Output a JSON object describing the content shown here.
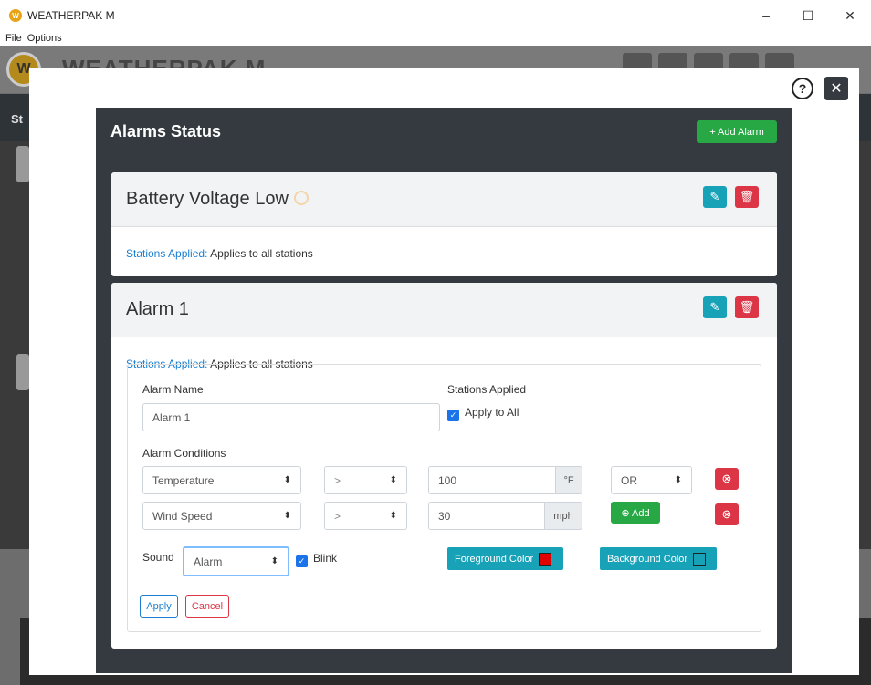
{
  "window": {
    "title": "WEATHERPAK M",
    "min": "–",
    "max": "☐",
    "close": "✕"
  },
  "menu": [
    "File",
    "Options"
  ],
  "app": {
    "logo_text": "W",
    "name": "WEATHERPAK M",
    "nav_text": "St"
  },
  "modal": {
    "help": "?",
    "close": "✕",
    "title": "Alarms Status",
    "add_alarm": "+  Add Alarm",
    "cards": [
      {
        "name": "Battery Voltage Low",
        "stations_label": "Stations Applied:",
        "stations_value": "Applies to all stations"
      },
      {
        "name": "Alarm 1",
        "stations_label": "Stations Applied:",
        "stations_value": "Applies to all stations"
      }
    ],
    "form": {
      "alarm_name_label": "Alarm Name",
      "alarm_name_value": "Alarm 1",
      "stations_applied_label": "Stations Applied",
      "apply_to_all": "Apply to All",
      "conditions_label": "Alarm Conditions",
      "conditions": [
        {
          "field": "Temperature",
          "operator": ">",
          "value": "100",
          "unit": "°F",
          "logic": "OR"
        },
        {
          "field": "Wind Speed",
          "operator": ">",
          "value": "30",
          "unit": "mph"
        }
      ],
      "add_label": "⊕ Add",
      "sound_label": "Sound",
      "sound_value": "Alarm",
      "blink_label": "Blink",
      "foreground_label": "Foreground Color",
      "background_label": "Background Color",
      "apply": "Apply",
      "cancel": "Cancel"
    }
  },
  "colors": {
    "foreground_swatch": "#e00000",
    "background_swatch": "#17a2b8"
  }
}
